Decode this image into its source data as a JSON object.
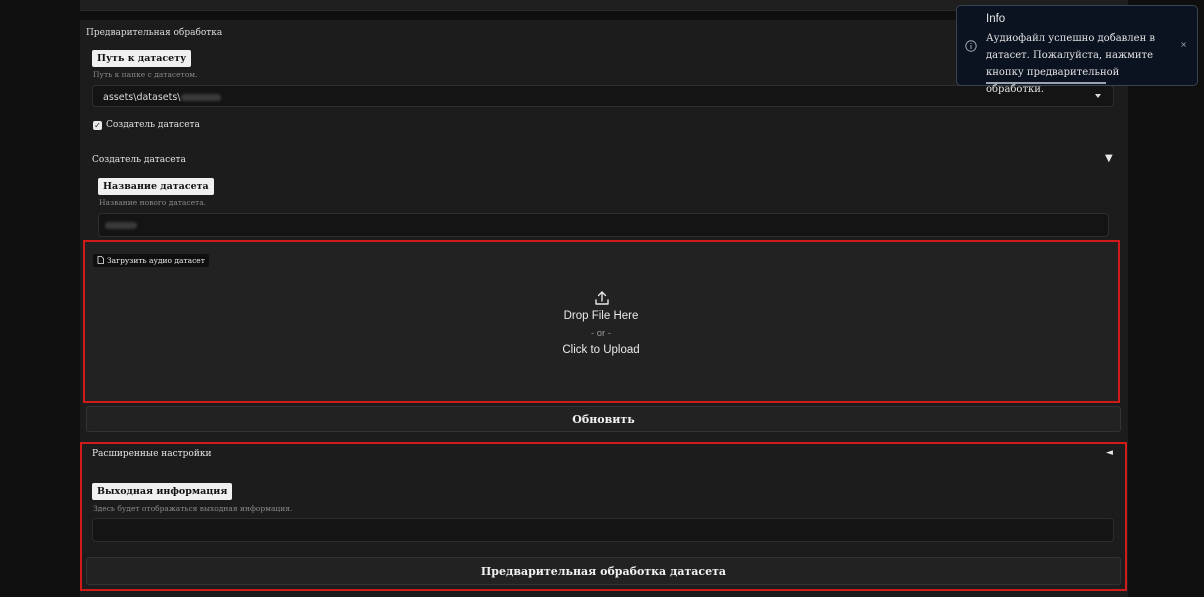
{
  "preprocessing": {
    "section_title": "Предварительная обработка",
    "dataset_path": {
      "label": "Путь к датасету",
      "hint": "Путь к папке с датасетом.",
      "value": "assets\\datasets\\"
    },
    "dataset_creator_checkbox": {
      "label": "Создатель датасета",
      "checked": true
    }
  },
  "dataset_creator": {
    "title": "Создатель датасета",
    "toggle_icon": "▼",
    "name": {
      "label": "Название датасета",
      "hint": "Название нового датасета."
    },
    "upload": {
      "label": "Загрузить аудио датасет",
      "drop_text": "Drop File Here",
      "or_text": "- or -",
      "click_text": "Click to Upload"
    }
  },
  "refresh_button": "Обновить",
  "advanced": {
    "title": "Расширенные настройки",
    "toggle_icon": "◄",
    "output": {
      "label": "Выходная информация",
      "hint": "Здесь будет отображаться выходная информация."
    }
  },
  "preprocess_button": "Предварительная обработка датасета",
  "toast": {
    "title": "Info",
    "message": "Аудиофайл успешно добавлен в датасет. Пожалуйста, нажмите кнопку предварительной обработки.",
    "close": "×",
    "icon": "info-circle-icon",
    "progress": 0.73
  },
  "colors": {
    "highlight": "#d11a1a",
    "panel": "#1c1c1c",
    "background": "#0f0f0f"
  }
}
